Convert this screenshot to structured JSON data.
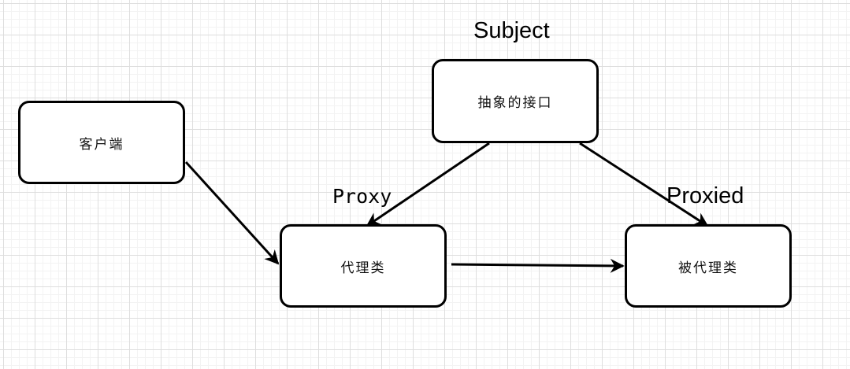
{
  "diagram": {
    "nodes": {
      "client": {
        "label": "客户端"
      },
      "subject": {
        "label": "抽象的接口"
      },
      "proxy": {
        "label": "代理类"
      },
      "proxied": {
        "label": "被代理类"
      }
    },
    "role_labels": {
      "subject": "Subject",
      "proxy": "Proxy",
      "proxied": "Proxied"
    },
    "edges": [
      {
        "from": "client",
        "to": "proxy"
      },
      {
        "from": "subject",
        "to": "proxy"
      },
      {
        "from": "subject",
        "to": "proxied"
      },
      {
        "from": "proxy",
        "to": "proxied"
      }
    ],
    "colors": {
      "stroke": "#000000",
      "grid": "#dedede"
    }
  }
}
